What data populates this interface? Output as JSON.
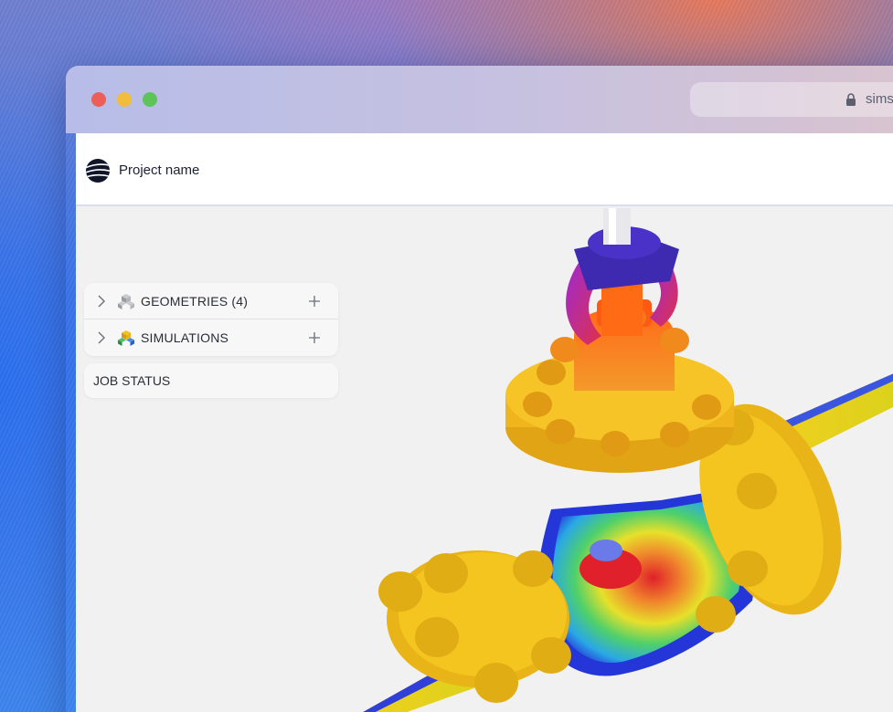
{
  "browser": {
    "url_text": "sims"
  },
  "header": {
    "project_name": "Project name"
  },
  "tree": {
    "items": [
      {
        "label": "GEOMETRIES (4)",
        "icon": "cubes-icon"
      },
      {
        "label": "SIMULATIONS",
        "icon": "simulation-cubes-icon"
      }
    ]
  },
  "job_status": {
    "label": "JOB STATUS"
  },
  "colors": {
    "traffic_red": "#ec5f58",
    "traffic_yellow": "#f1bb3b",
    "traffic_green": "#5dc458",
    "flange_yellow": "#f4c51f",
    "gradient_orange": "#f08a2c",
    "yoke_purple": "#4a28b8"
  }
}
